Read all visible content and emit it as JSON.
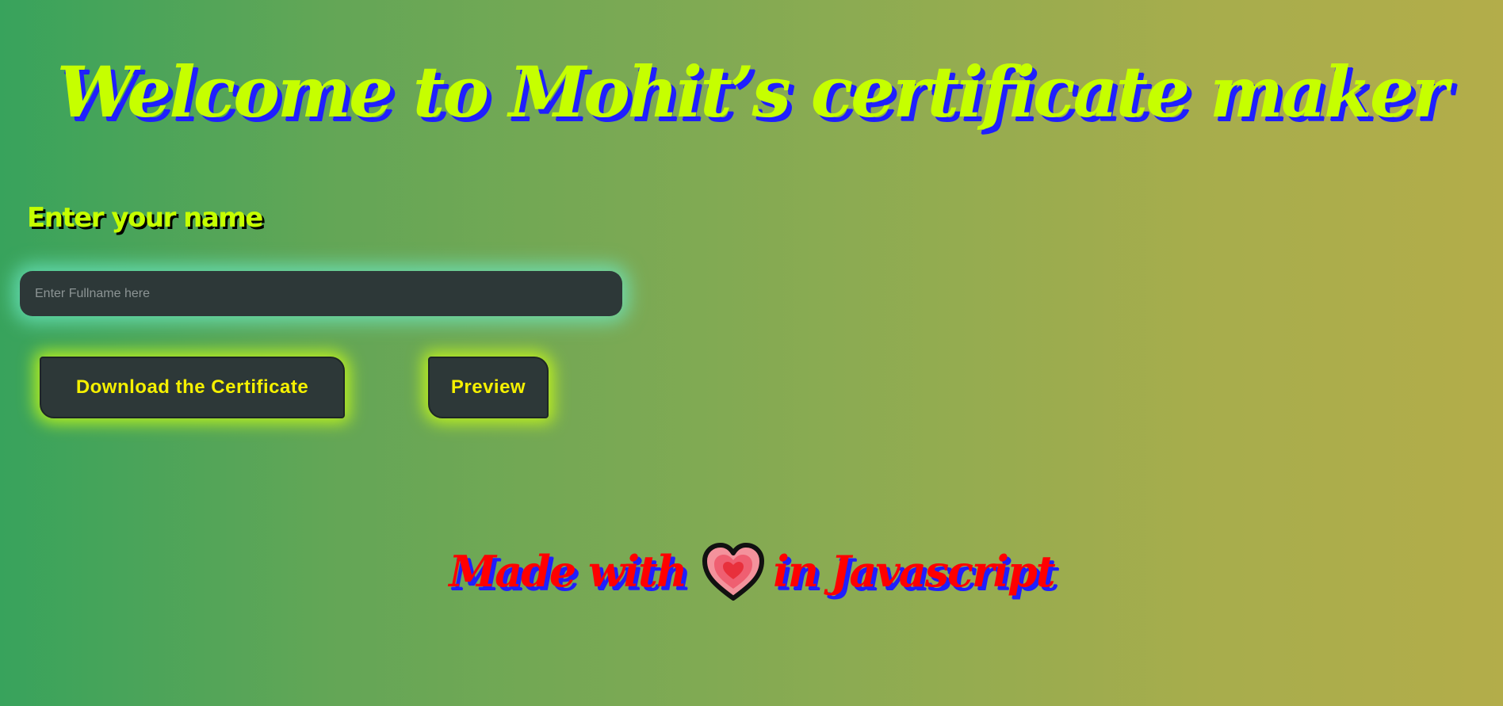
{
  "header": {
    "title": "Welcome to Mohit’s certificate maker"
  },
  "form": {
    "name_label": "Enter your name",
    "name_input_placeholder": "Enter Fullname here",
    "name_input_value": "",
    "download_button_label": "Download the Certificate",
    "preview_button_label": "Preview"
  },
  "footer": {
    "text_before": "Made with",
    "icon": "heart-icon",
    "text_after": "in Javascript"
  },
  "colors": {
    "title": "#c6ff00",
    "title_shadow": "#1f1fff",
    "label_shadow": "#000000",
    "input_background": "#2d3838",
    "input_glow": "#6eebc8",
    "button_text": "#f5f000",
    "button_glow": "#cdff14",
    "footer_text": "#ff0000",
    "heart": "#e8303c"
  }
}
